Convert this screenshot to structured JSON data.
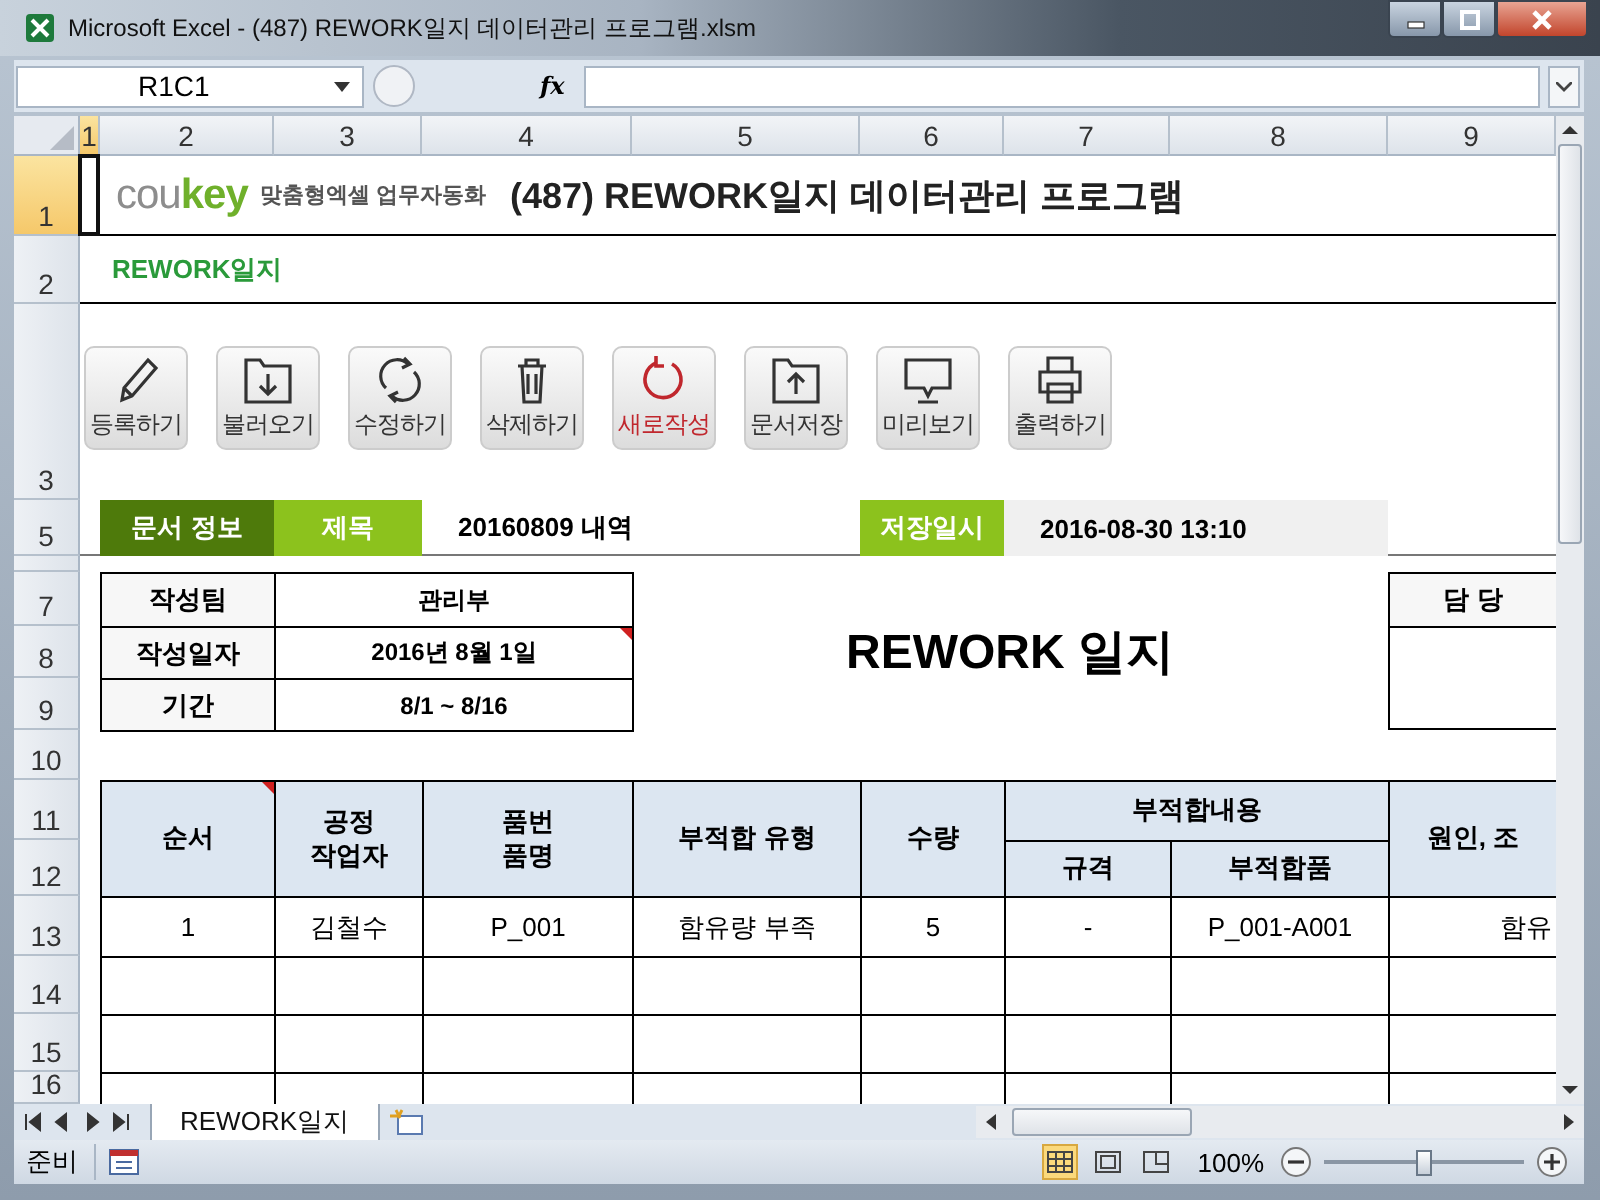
{
  "window": {
    "title": "Microsoft Excel - (487) REWORK일지 데이터관리 프로그램.xlsm"
  },
  "formula_bar": {
    "name_box": "R1C1",
    "fx": "fx"
  },
  "columns": [
    {
      "label": "1",
      "selected": true
    },
    {
      "label": "2",
      "selected": false
    },
    {
      "label": "3",
      "selected": false
    },
    {
      "label": "4",
      "selected": false
    },
    {
      "label": "5",
      "selected": false
    },
    {
      "label": "6",
      "selected": false
    },
    {
      "label": "7",
      "selected": false
    },
    {
      "label": "8",
      "selected": false
    },
    {
      "label": "9",
      "selected": false
    }
  ],
  "rows": [
    {
      "label": "1",
      "selected": true
    },
    {
      "label": "2",
      "selected": false
    },
    {
      "label": "3",
      "selected": false
    },
    {
      "label": "5",
      "selected": false
    },
    {
      "label": "7",
      "selected": false
    },
    {
      "label": "8",
      "selected": false
    },
    {
      "label": "9",
      "selected": false
    },
    {
      "label": "10",
      "selected": false
    },
    {
      "label": "11",
      "selected": false
    },
    {
      "label": "12",
      "selected": false
    },
    {
      "label": "13",
      "selected": false
    },
    {
      "label": "14",
      "selected": false
    },
    {
      "label": "15",
      "selected": false
    },
    {
      "label": "16",
      "selected": false
    }
  ],
  "sheet": {
    "logo": {
      "gray": "cou",
      "green": "key"
    },
    "tagline": "맞춤형엑셀 업무자동화",
    "title": "(487) REWORK일지 데이터관리 프로그램",
    "subtitle": "REWORK일지",
    "toolbar": [
      {
        "kind": "edit",
        "label": "등록하기",
        "accent": false
      },
      {
        "kind": "load",
        "label": "불러오기",
        "accent": false
      },
      {
        "kind": "update",
        "label": "수정하기",
        "accent": false
      },
      {
        "kind": "delete",
        "label": "삭제하기",
        "accent": false
      },
      {
        "kind": "new",
        "label": "새로작성",
        "accent": true
      },
      {
        "kind": "save",
        "label": "문서저장",
        "accent": false
      },
      {
        "kind": "preview",
        "label": "미리보기",
        "accent": false
      },
      {
        "kind": "print",
        "label": "출력하기",
        "accent": false
      }
    ],
    "info": {
      "section": "문서 정보",
      "title_label": "제목",
      "title_value": "20160809 내역",
      "saved_label": "저장일시",
      "saved_value": "2016-08-30 13:10"
    },
    "meta": [
      {
        "label": "작성팀",
        "value": "관리부",
        "comment": false
      },
      {
        "label": "작성일자",
        "value": "2016년 8월 1일",
        "comment": true
      },
      {
        "label": "기간",
        "value": "8/1 ~ 8/16",
        "comment": false
      }
    ],
    "doc_title": "REWORK 일지",
    "approval": "담 당",
    "table": {
      "columns": [
        {
          "lines": [
            "순서"
          ],
          "comment": true
        },
        {
          "lines": [
            "공정",
            "작업자"
          ],
          "comment": false
        },
        {
          "lines": [
            "품번",
            "품명"
          ],
          "comment": false
        },
        {
          "lines": [
            "부적합 유형"
          ],
          "comment": false
        },
        {
          "lines": [
            "수량"
          ],
          "comment": false
        }
      ],
      "group": {
        "label": "부적합내용",
        "sub": [
          "규격",
          "부적합품"
        ]
      },
      "last_column": "원인, 조",
      "rows": [
        [
          "1",
          "김철수",
          "P_001",
          "함유량 부족",
          "5",
          "-",
          "P_001-A001",
          "함유"
        ]
      ]
    }
  },
  "sheet_tabs": [
    {
      "label": "REWORK일지",
      "selected": true
    }
  ],
  "status_bar": {
    "mode": "준비",
    "views": [
      {
        "kind": "normal",
        "selected": true
      },
      {
        "kind": "layout",
        "selected": false
      },
      {
        "kind": "pagebreak",
        "selected": false
      }
    ],
    "zoom": "100%",
    "zoom_slider": {
      "level": 0.5
    }
  }
}
